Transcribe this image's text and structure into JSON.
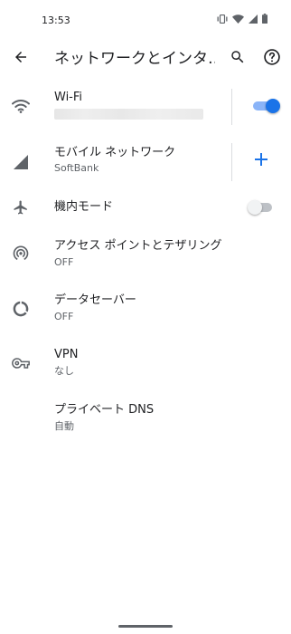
{
  "status_bar": {
    "time": "13:53"
  },
  "app_bar": {
    "title": "ネットワークとインタ…",
    "icons": [
      "back-arrow-icon",
      "search-icon",
      "help-icon"
    ]
  },
  "rows": [
    {
      "key": "wifi",
      "icon": "wifi-icon",
      "title": "Wi-Fi",
      "subtitle_redacted": true,
      "control": "toggle",
      "toggle_on": true
    },
    {
      "key": "mobile",
      "icon": "cellular-signal-icon",
      "title": "モバイル ネットワーク",
      "subtitle": "SoftBank",
      "control": "add",
      "add_symbol": "+"
    },
    {
      "key": "airplane",
      "icon": "airplane-icon",
      "title": "機内モード",
      "control": "toggle",
      "toggle_on": false
    },
    {
      "key": "hotspot",
      "icon": "hotspot-icon",
      "title": "アクセス ポイントとテザリング",
      "subtitle": "OFF"
    },
    {
      "key": "datasaver",
      "icon": "data-saver-icon",
      "title": "データセーバー",
      "subtitle": "OFF"
    },
    {
      "key": "vpn",
      "icon": "vpn-key-icon",
      "title": "VPN",
      "subtitle": "なし"
    },
    {
      "key": "dns",
      "title": "プライベート DNS",
      "subtitle": "自動"
    }
  ],
  "colors": {
    "accent": "#1a73e8",
    "accent_track": "#8ab4f8",
    "text_primary": "#202124",
    "text_secondary": "#5f6368",
    "icon": "#5f6368"
  }
}
